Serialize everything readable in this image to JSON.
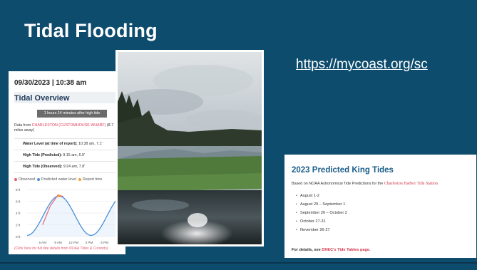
{
  "slide": {
    "title": "Tidal Flooding",
    "link": "https://mycoast.org/sc"
  },
  "tide_card": {
    "date": "09/30/2023 | 10:38 am",
    "heading": "Tidal Overview",
    "pill": "1 hours 14 minutes after high tide",
    "data_prefix": "Data from ",
    "data_station": "CHARLESTON (CUSTOMHOUSE WHARF)",
    "data_suffix": " (8.7 miles away)",
    "rows": [
      {
        "label": "Water Level (at time of report):",
        "value": "10:38 am, 7.1'"
      },
      {
        "label": "High Tide (Predicted):",
        "value": "9:15 am, 6.9'"
      },
      {
        "label": "High Tide (Observed):",
        "value": "9:24 am, 7.8'"
      }
    ],
    "legend": {
      "observed": "Observed",
      "predicted": "Predicted water level",
      "report": "Report time",
      "observed_color": "#e85a6c",
      "predicted_color": "#4a8fd6",
      "report_color": "#f0a23b"
    },
    "footnote": "(Click here for full tide details from NOAA Tides & Currents)"
  },
  "chart_data": {
    "type": "line",
    "x": [
      "6 AM",
      "9 AM",
      "12 PM",
      "3 PM",
      "6 PM",
      "9 PM"
    ],
    "y_ticks": [
      "8 ft",
      "6 ft",
      "4 ft",
      "2 ft",
      "0 ft"
    ],
    "ylim": [
      0,
      8
    ],
    "series": [
      {
        "name": "Observed",
        "color": "#e85a6c",
        "points": [
          [
            3.0,
            2.0
          ],
          [
            4.5,
            5.2
          ],
          [
            6.0,
            7.1
          ],
          [
            7.0,
            6.8
          ]
        ]
      },
      {
        "name": "Predicted water level",
        "color": "#4a8fd6",
        "points": [
          [
            0.0,
            1.0
          ],
          [
            3.0,
            6.9
          ],
          [
            6.0,
            0.2
          ],
          [
            9.0,
            6.9
          ],
          [
            9.5,
            6.5
          ]
        ]
      }
    ],
    "report_time": [
      6.2,
      6.9
    ]
  },
  "king_card": {
    "title": "2023 Predicted King Tides",
    "based_prefix": "Based on NOAA Astronomical Tide Predictions for the ",
    "based_station": "Charleston Harbor Tide Station",
    "dates": [
      "August 1-2",
      "August 29 – September 1",
      "September 26 – October 2",
      "October 27-31",
      "November 26-27"
    ],
    "details_prefix": "For details, see ",
    "details_link": "DHEC's Tide Tables page."
  }
}
